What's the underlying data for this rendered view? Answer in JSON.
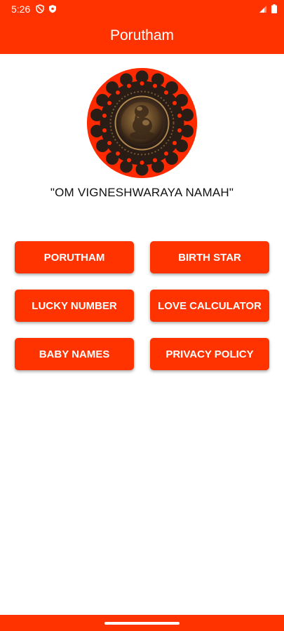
{
  "status_bar": {
    "time": "5:26",
    "left_icons": [
      "shield-icon",
      "vpn-shield-icon"
    ],
    "right_icons": [
      "signal-icon",
      "battery-icon"
    ]
  },
  "app_bar": {
    "title": "Porutham"
  },
  "mantra": "\"OM VIGNESHWARAYA NAMAH\"",
  "menu": {
    "items": [
      {
        "label": "PORUTHAM"
      },
      {
        "label": "BIRTH STAR"
      },
      {
        "label": "LUCKY NUMBER"
      },
      {
        "label": "LOVE CALCULATOR"
      },
      {
        "label": "BABY NAMES"
      },
      {
        "label": "PRIVACY POLICY"
      }
    ]
  },
  "colors": {
    "accent": "#ff3300",
    "text": "#111111",
    "background": "#ffffff"
  }
}
